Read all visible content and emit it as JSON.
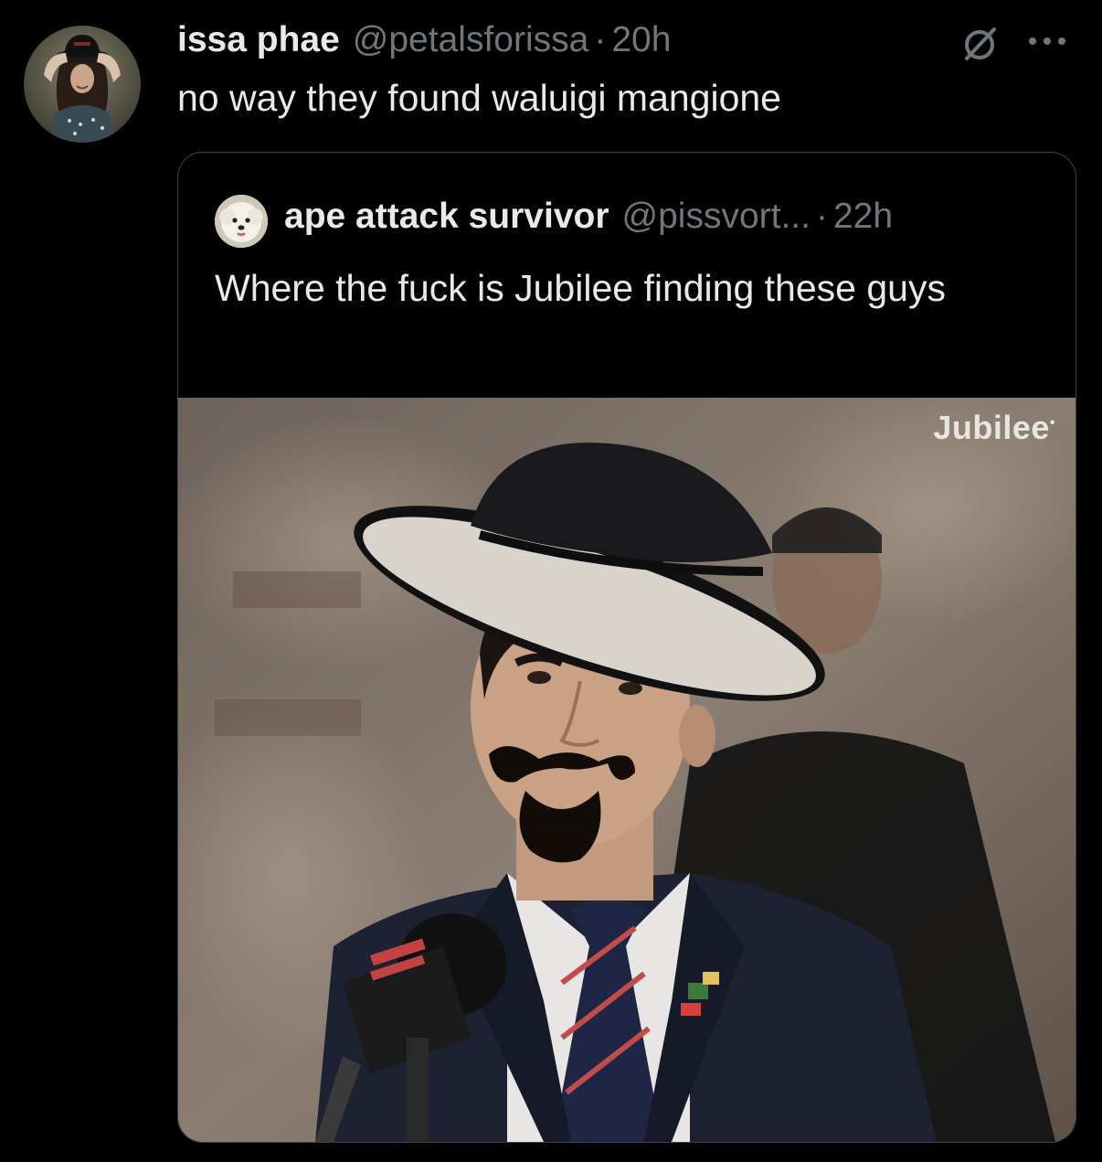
{
  "tweet": {
    "display_name": "issa phae",
    "handle": "@petalsforissa",
    "separator": "·",
    "time": "20h",
    "text": "no way they found waluigi mangione",
    "avatar_icon": "user-avatar",
    "edit_icon": "edited-circle-slash-icon",
    "more_icon": "more-dots-icon"
  },
  "quote": {
    "display_name": "ape attack survivor",
    "handle": "@pissvort...",
    "separator": "·",
    "time": "22h",
    "text": "Where the fuck is Jubilee finding these guys",
    "avatar_icon": "dog-avatar",
    "image": {
      "watermark": "Jubilee",
      "watermark_mark": "•"
    }
  },
  "colors": {
    "background": "#000000",
    "primary_text": "#e7e9ea",
    "secondary_text": "#71767b",
    "border": "#3e4144"
  }
}
